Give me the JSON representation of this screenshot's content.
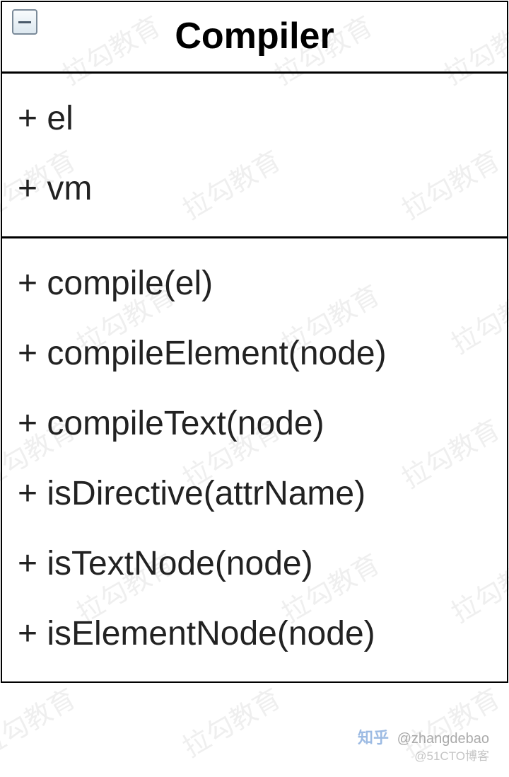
{
  "class_name": "Compiler",
  "properties": [
    "+ el",
    "+ vm"
  ],
  "methods": [
    "+ compile(el)",
    "+ compileElement(node)",
    "+ compileText(node)",
    "+ isDirective(attrName)",
    "+ isTextNode(node)",
    "+ isElementNode(node)"
  ],
  "watermark_text": "拉勾教育",
  "attribution": {
    "line1_prefix": "知乎",
    "line1_handle": "@zhangdebao",
    "line2": "@51CTO博客"
  }
}
